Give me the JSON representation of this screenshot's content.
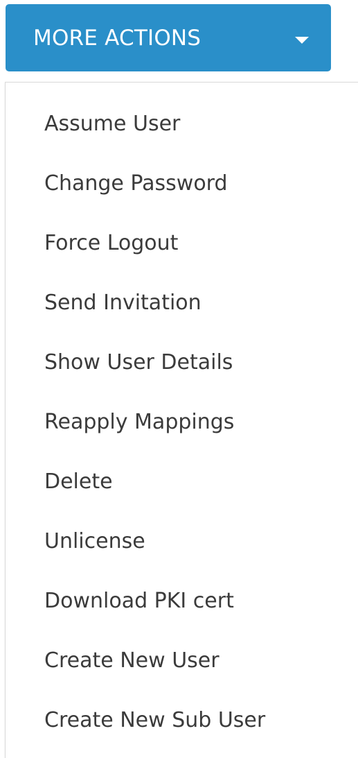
{
  "more_actions": {
    "label": "MORE ACTIONS",
    "icon": "caret-down-icon"
  },
  "menu": {
    "items": [
      {
        "label": "Assume User"
      },
      {
        "label": "Change Password"
      },
      {
        "label": "Force Logout"
      },
      {
        "label": "Send Invitation"
      },
      {
        "label": "Show User Details"
      },
      {
        "label": "Reapply Mappings"
      },
      {
        "label": "Delete"
      },
      {
        "label": "Unlicense"
      },
      {
        "label": "Download PKI cert"
      },
      {
        "label": "Create New User"
      },
      {
        "label": "Create New Sub User"
      }
    ]
  },
  "colors": {
    "button_bg": "#2a8fc9",
    "button_text": "#ffffff",
    "menu_text": "#3b3b3b",
    "menu_border": "#d9d9d9"
  }
}
